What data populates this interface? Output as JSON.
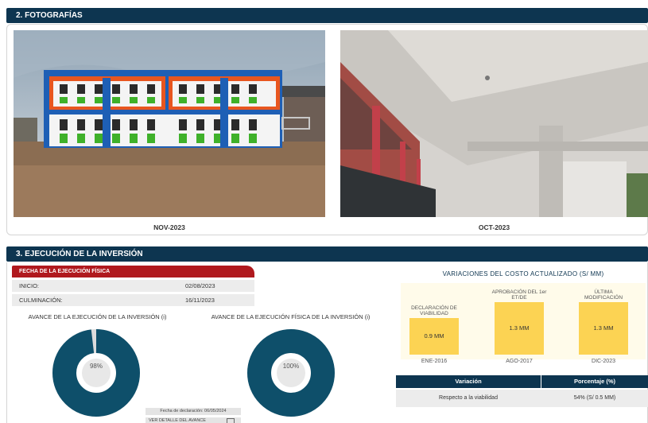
{
  "section2": {
    "title": "2. FOTOGRAFÍAS"
  },
  "photos": [
    {
      "caption": "NOV-2023"
    },
    {
      "caption": "OCT-2023"
    }
  ],
  "section3": {
    "title": "3. EJECUCIÓN DE LA INVERSIÓN"
  },
  "fecha_ejecucion": {
    "header": "FECHA DE LA EJECUCIÓN FÍSICA",
    "inicio_label": "INICIO:",
    "inicio_value": "02/08/2023",
    "culminacion_label": "CULMINACIÓN:",
    "culminacion_value": "16/11/2023"
  },
  "avance_inversion": {
    "title": "AVANCE DE LA EJECUCIÓN DE LA INVERSIÓN (i)",
    "label": "98%",
    "percent": 98
  },
  "avance_fisica": {
    "title": "AVANCE DE LA EJECUCIÓN FÍSICA DE LA INVERSIÓN (i)",
    "label": "100%",
    "percent": 100
  },
  "fecha_declaracion": "Fecha de declaración: 06/05/2024",
  "ver_detalle": "VER DETALLE DEL AVANCE",
  "colors": {
    "navy": "#0d3550",
    "red": "#b0191e",
    "donut": "#0e4f6a",
    "bar": "#fcd353"
  },
  "chart_data": {
    "type": "bar",
    "title": "VARIACIONES DEL COSTO ACTUALIZADO (S/ MM)",
    "categories": [
      "ENE-2016",
      "AGO-2017",
      "DIC-2023"
    ],
    "bar_labels": [
      "DECLARACIÓN DE VIABILIDAD",
      "APROBACIÓN DEL 1er ET/DE",
      "ÚLTIMA MODIFICACIÓN"
    ],
    "values": [
      0.9,
      1.3,
      1.3
    ],
    "value_labels": [
      "0.9 MM",
      "1.3 MM",
      "1.3 MM"
    ]
  },
  "variacion_table": {
    "headers": [
      "Variación",
      "Porcentaje (%)"
    ],
    "rows": [
      [
        "Respecto a la viabilidad",
        "54% (S/ 0.5 MM)"
      ]
    ]
  }
}
